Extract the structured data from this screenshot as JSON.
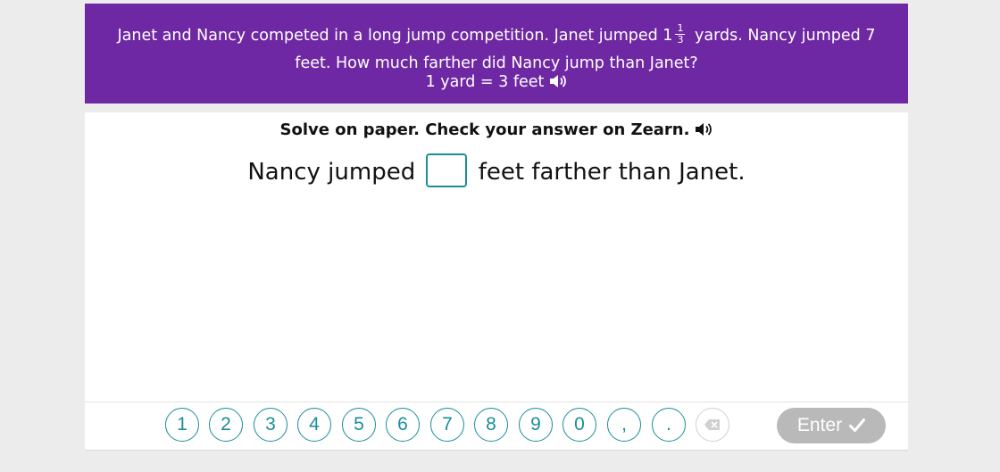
{
  "problem": {
    "line1_before": "Janet and Nancy competed in a long jump competition. Janet jumped 1",
    "fraction_numerator": "1",
    "fraction_denominator": "3",
    "line1_after": " yards. Nancy jumped 7",
    "line2": "feet. How much farther did Nancy jump than Janet?",
    "line3": "1 yard = 3 feet"
  },
  "workspace": {
    "instruction": "Solve on paper. Check your answer on Zearn.",
    "sentence_before": "Nancy jumped",
    "sentence_after": "feet farther than Janet."
  },
  "keypad": {
    "keys": [
      "1",
      "2",
      "3",
      "4",
      "5",
      "6",
      "7",
      "8",
      "9",
      "0",
      ",",
      "."
    ],
    "enter_label": "Enter"
  },
  "colors": {
    "banner": "#6f28a3",
    "accent": "#1a8d9a",
    "enter_disabled": "#b9b9b9"
  },
  "icons": [
    "speaker-icon",
    "backspace-icon",
    "checkmark-icon"
  ]
}
